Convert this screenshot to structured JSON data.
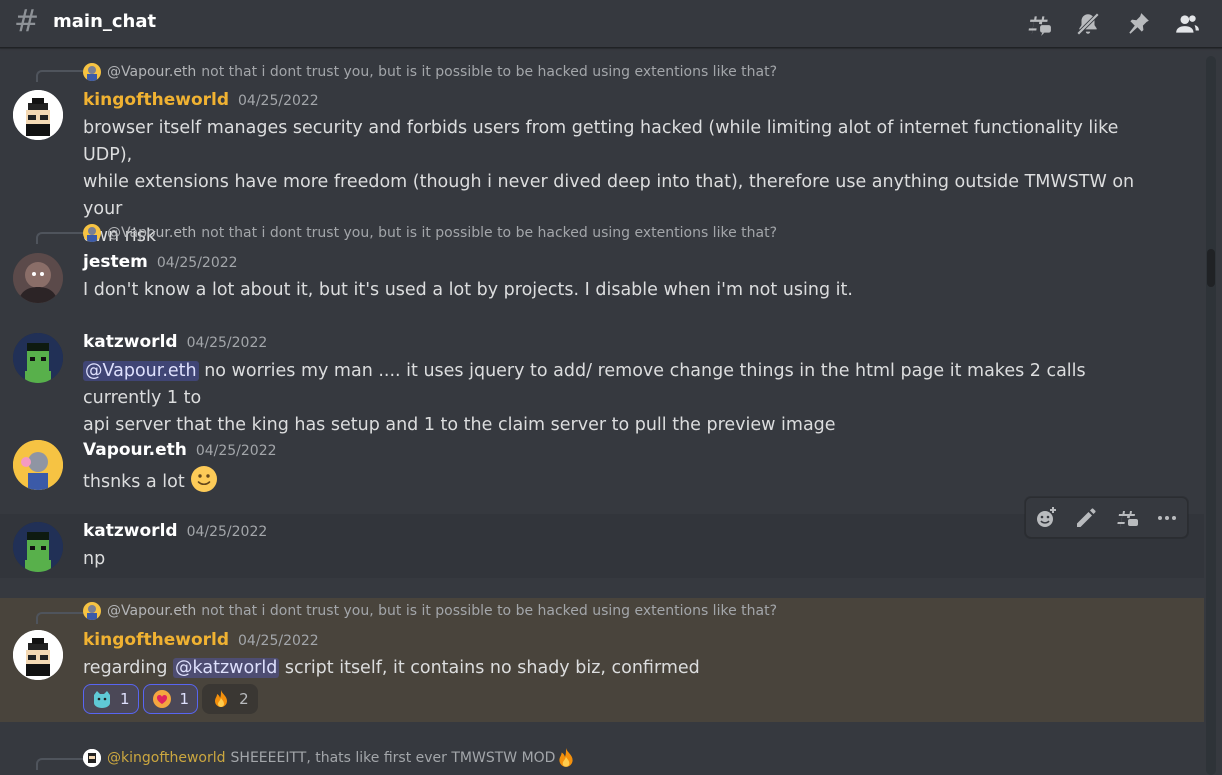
{
  "header": {
    "channel_name": "main_chat",
    "icons": [
      "threads-icon",
      "mute-bell-icon",
      "pin-icon",
      "members-icon"
    ]
  },
  "messages": [
    {
      "reply": {
        "user": "@Vapour.eth",
        "text": "not that i dont trust you, but is it possible to be hacked using extentions like that?"
      },
      "author": "kingoftheworld",
      "timestamp": "04/25/2022",
      "line1": "browser itself manages security and forbids users from getting hacked (while limiting alot of internet functionality like UDP),",
      "line2": "while extensions have more freedom (though i never dived deep into that), therefore use anything outside TMWSTW on your",
      "line3": "own risk"
    },
    {
      "reply": {
        "user": "@Vapour.eth",
        "text": "not that i dont trust you, but is it possible to be hacked using extentions like that?"
      },
      "author": "jestem",
      "timestamp": "04/25/2022",
      "line1": "I don't know a lot about it, but it's used a lot by projects.  I disable when i'm not using it."
    },
    {
      "author": "katzworld",
      "timestamp": "04/25/2022",
      "mention": "@Vapour.eth",
      "line1_rest": " no worries my man ....  it uses jquery to add/ remove change things in the html page it makes 2 calls currently 1 to",
      "line2": "api server that the king has setup and 1 to the claim server to pull the preview image"
    },
    {
      "author": "Vapour.eth",
      "timestamp": "04/25/2022",
      "line1": "thsnks a lot "
    },
    {
      "author": "katzworld",
      "timestamp": "04/25/2022",
      "line1": "np"
    },
    {
      "reply": {
        "user": "@Vapour.eth",
        "text": "not that i dont trust you, but is it possible to be hacked using extentions like that?"
      },
      "author": "kingoftheworld",
      "timestamp": "04/25/2022",
      "prefix": "regarding ",
      "mention": "@katzworld",
      "suffix": " script itself, it contains no shady biz, confirmed",
      "reactions": [
        {
          "icon": "cat-emoji-icon",
          "count": "1"
        },
        {
          "icon": "heart-face-emoji-icon",
          "count": "1"
        },
        {
          "icon": "fire-emoji-icon",
          "count": "2"
        }
      ]
    },
    {
      "reply": {
        "user": "@kingoftheworld",
        "text": "SHEEEEITT, thats like first ever TMWSTW MOD "
      }
    }
  ],
  "colors": {
    "background": "#36393f",
    "gold_name": "#f0b232",
    "mention_highlight": "#49443c",
    "blurple": "#5865f2"
  }
}
